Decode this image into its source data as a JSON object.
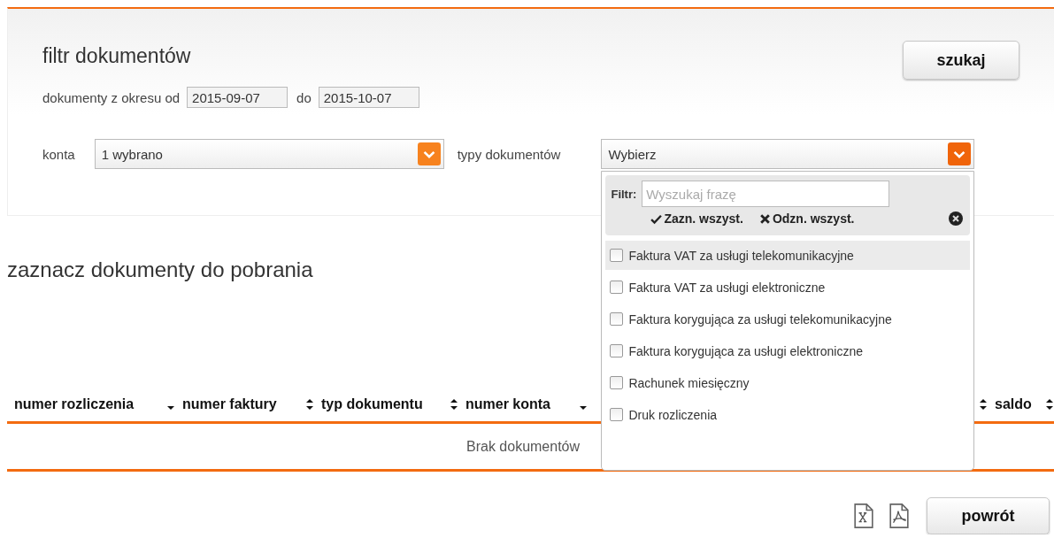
{
  "filter": {
    "title": "filtr dokumentów",
    "search_button": "szukaj",
    "period": {
      "label": "dokumenty z okresu od",
      "from": "2015-09-07",
      "to_label": "do",
      "to": "2015-10-07"
    },
    "selects": [
      {
        "label": "konta",
        "value": "1 wybrano",
        "expanded": false
      },
      {
        "label": "typy dokumentów",
        "value": "Wybierz",
        "expanded": true,
        "dropdown": {
          "filter_label": "Filtr:",
          "placeholder": "Wyszukaj frazę",
          "select_all": "Zazn. wszyst.",
          "deselect_all": "Odzn. wszyst.",
          "options": [
            {
              "label": "Faktura VAT za usługi telekomunikacyjne",
              "checked": false,
              "highlighted": true
            },
            {
              "label": "Faktura VAT za usługi elektroniczne",
              "checked": false,
              "highlighted": false
            },
            {
              "label": "Faktura korygująca za usługi telekomunikacyjne",
              "checked": false,
              "highlighted": false
            },
            {
              "label": "Faktura korygująca za usługi elektroniczne",
              "checked": false,
              "highlighted": false
            },
            {
              "label": "Rachunek miesięczny",
              "checked": false,
              "highlighted": false
            },
            {
              "label": "Druk rozliczenia",
              "checked": false,
              "highlighted": false
            }
          ]
        }
      }
    ]
  },
  "documents": {
    "title": "zaznacz dokumenty do pobrania",
    "columns": [
      {
        "label": "numer rozliczenia",
        "sorted": true
      },
      {
        "label": "numer faktury",
        "sorted": false
      },
      {
        "label": "typ dokumentu",
        "sorted": false
      },
      {
        "label": "numer konta",
        "sorted": true
      },
      {
        "sorted": false
      },
      {
        "label": "saldo",
        "sorted": false
      }
    ],
    "empty_message": "Brak dokumentów"
  },
  "footer": {
    "back_button": "powrót"
  }
}
